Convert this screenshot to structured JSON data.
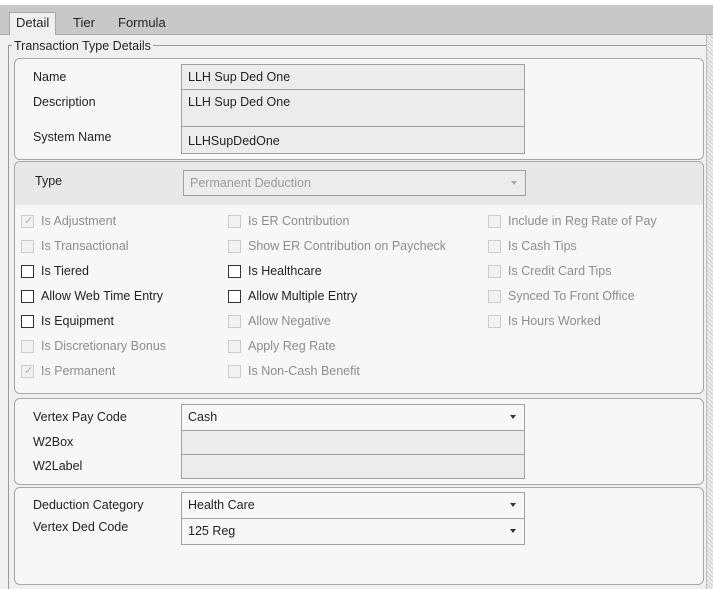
{
  "tabs": [
    {
      "label": "Detail"
    },
    {
      "label": "Tier"
    },
    {
      "label": "Formula"
    }
  ],
  "group_title": "Transaction Type Details",
  "identity": {
    "name_label": "Name",
    "name_value": "LLH Sup Ded One",
    "description_label": "Description",
    "description_value": "LLH Sup Ded One",
    "system_name_label": "System Name",
    "system_name_value": "LLHSupDedOne"
  },
  "type": {
    "label": "Type",
    "value": "Permanent Deduction"
  },
  "checkboxes": {
    "col1": [
      {
        "label": "Is Adjustment",
        "checked": true,
        "enabled": false
      },
      {
        "label": "Is Transactional",
        "checked": false,
        "enabled": false
      },
      {
        "label": "Is Tiered",
        "checked": false,
        "enabled": true
      },
      {
        "label": "Allow Web Time Entry",
        "checked": false,
        "enabled": true
      },
      {
        "label": "Is Equipment",
        "checked": false,
        "enabled": true
      },
      {
        "label": "Is Discretionary Bonus",
        "checked": false,
        "enabled": false
      },
      {
        "label": "Is Permanent",
        "checked": true,
        "enabled": false
      }
    ],
    "col2": [
      {
        "label": "Is ER Contribution",
        "checked": false,
        "enabled": false
      },
      {
        "label": "Show ER Contribution on Paycheck",
        "checked": false,
        "enabled": false
      },
      {
        "label": "Is Healthcare",
        "checked": false,
        "enabled": true
      },
      {
        "label": "Allow Multiple Entry",
        "checked": false,
        "enabled": true
      },
      {
        "label": "Allow Negative",
        "checked": false,
        "enabled": false
      },
      {
        "label": "Apply Reg Rate",
        "checked": false,
        "enabled": false
      },
      {
        "label": "Is Non-Cash Benefit",
        "checked": false,
        "enabled": false
      }
    ],
    "col3": [
      {
        "label": "Include in Reg Rate of Pay",
        "checked": false,
        "enabled": false
      },
      {
        "label": "Is Cash Tips",
        "checked": false,
        "enabled": false
      },
      {
        "label": "Is Credit Card Tips",
        "checked": false,
        "enabled": false
      },
      {
        "label": "Synced To Front Office",
        "checked": false,
        "enabled": false
      },
      {
        "label": "Is Hours Worked",
        "checked": false,
        "enabled": false
      }
    ]
  },
  "vertex": {
    "pay_code_label": "Vertex Pay Code",
    "pay_code_value": "Cash",
    "w2box_label": "W2Box",
    "w2box_value": "",
    "w2label_label": "W2Label",
    "w2label_value": ""
  },
  "deduction": {
    "category_label": "Deduction Category",
    "category_value": "Health Care",
    "ded_code_label": "Vertex Ded Code",
    "ded_code_value": "125 Reg"
  },
  "colors": {
    "tabstrip": "#c8c8c8",
    "panel": "#f0f0f0",
    "field": "#ececec",
    "disabled_text": "#9a9a9a"
  }
}
